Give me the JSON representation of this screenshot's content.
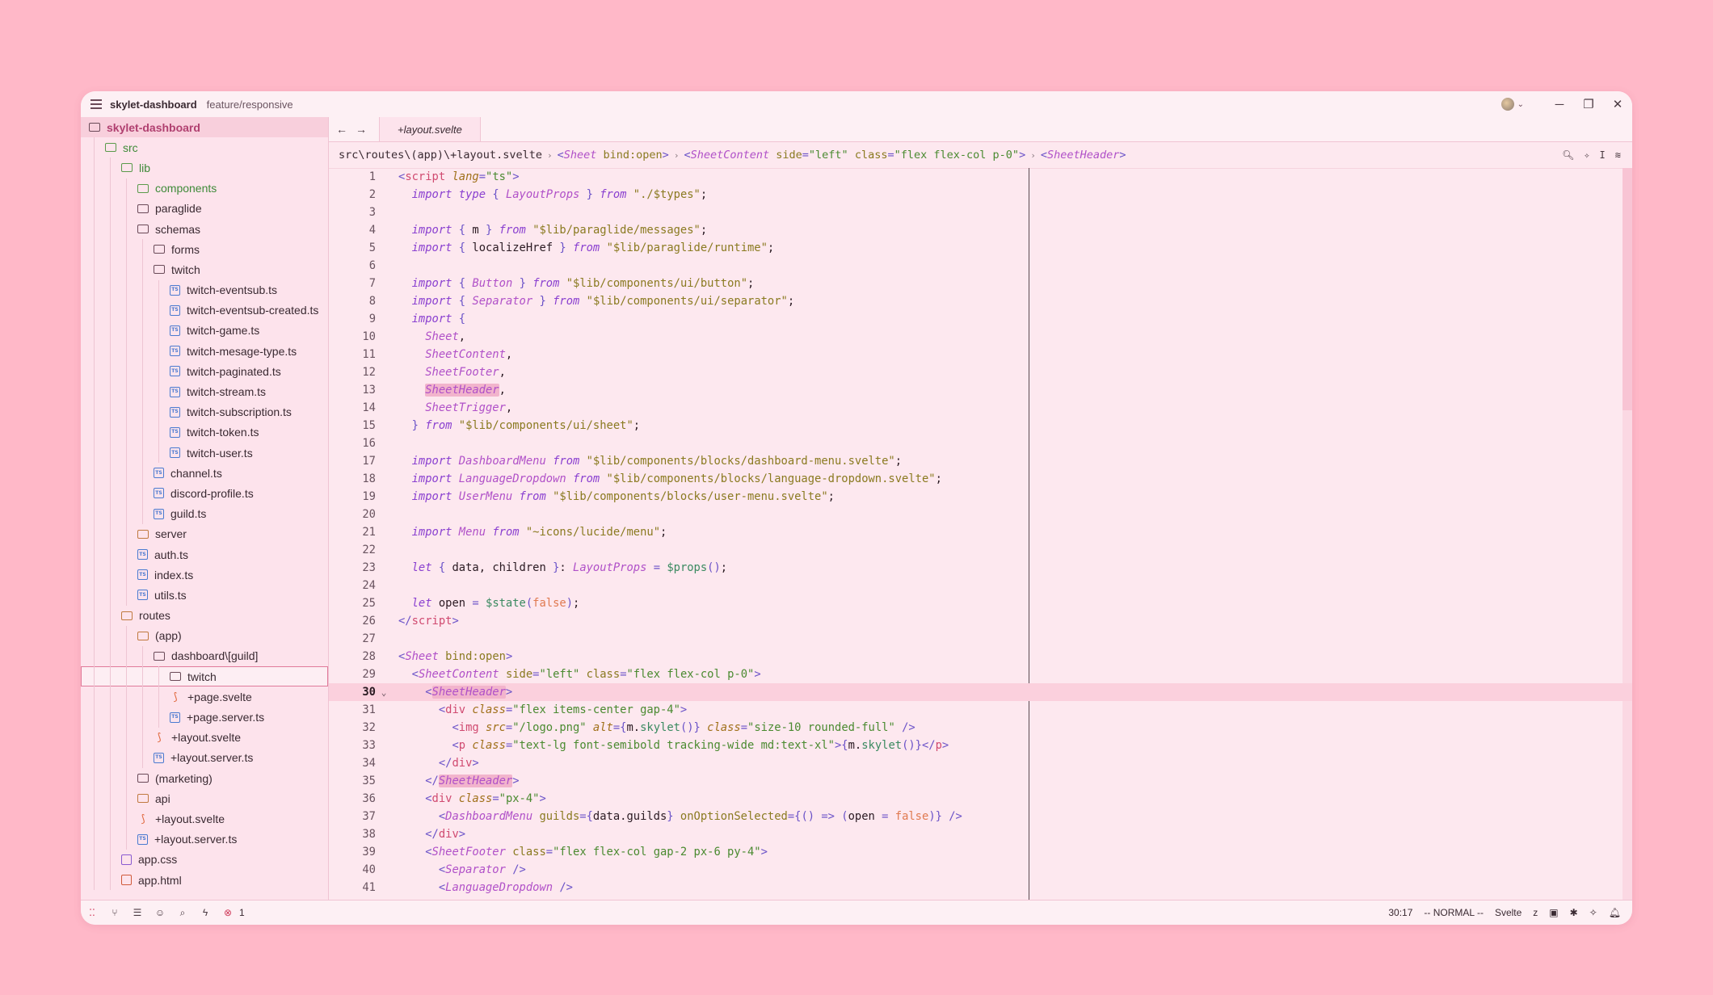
{
  "titlebar": {
    "project": "skylet-dashboard",
    "branch": "feature/responsive"
  },
  "sidebar": {
    "items": [
      {
        "label": "skylet-dashboard",
        "depth": 0,
        "icon": "folder-icon",
        "kind": "root"
      },
      {
        "label": "src",
        "depth": 1,
        "icon": "folder-icon",
        "color": "green"
      },
      {
        "label": "lib",
        "depth": 2,
        "icon": "folder-icon",
        "color": "green"
      },
      {
        "label": "components",
        "depth": 3,
        "icon": "folder-icon",
        "color": "green"
      },
      {
        "label": "paraglide",
        "depth": 3,
        "icon": "folder-icon"
      },
      {
        "label": "schemas",
        "depth": 3,
        "icon": "folder-icon"
      },
      {
        "label": "forms",
        "depth": 4,
        "icon": "folder-icon"
      },
      {
        "label": "twitch",
        "depth": 4,
        "icon": "folder-icon"
      },
      {
        "label": "twitch-eventsub.ts",
        "depth": 5,
        "icon": "ts-file-icon"
      },
      {
        "label": "twitch-eventsub-created.ts",
        "depth": 5,
        "icon": "ts-file-icon"
      },
      {
        "label": "twitch-game.ts",
        "depth": 5,
        "icon": "ts-file-icon"
      },
      {
        "label": "twitch-mesage-type.ts",
        "depth": 5,
        "icon": "ts-file-icon"
      },
      {
        "label": "twitch-paginated.ts",
        "depth": 5,
        "icon": "ts-file-icon"
      },
      {
        "label": "twitch-stream.ts",
        "depth": 5,
        "icon": "ts-file-icon"
      },
      {
        "label": "twitch-subscription.ts",
        "depth": 5,
        "icon": "ts-file-icon"
      },
      {
        "label": "twitch-token.ts",
        "depth": 5,
        "icon": "ts-file-icon"
      },
      {
        "label": "twitch-user.ts",
        "depth": 5,
        "icon": "ts-file-icon"
      },
      {
        "label": "channel.ts",
        "depth": 4,
        "icon": "ts-file-icon"
      },
      {
        "label": "discord-profile.ts",
        "depth": 4,
        "icon": "ts-file-icon"
      },
      {
        "label": "guild.ts",
        "depth": 4,
        "icon": "ts-file-icon"
      },
      {
        "label": "server",
        "depth": 3,
        "icon": "folder-icon",
        "color": "orange"
      },
      {
        "label": "auth.ts",
        "depth": 3,
        "icon": "ts-file-icon"
      },
      {
        "label": "index.ts",
        "depth": 3,
        "icon": "ts-file-icon"
      },
      {
        "label": "utils.ts",
        "depth": 3,
        "icon": "ts-file-icon"
      },
      {
        "label": "routes",
        "depth": 2,
        "icon": "folder-icon",
        "color": "orange"
      },
      {
        "label": "(app)",
        "depth": 3,
        "icon": "folder-icon",
        "color": "orange"
      },
      {
        "label": "dashboard\\[guild]",
        "depth": 4,
        "icon": "folder-icon"
      },
      {
        "label": "twitch",
        "depth": 5,
        "icon": "folder-icon",
        "kind": "selected"
      },
      {
        "label": "+page.svelte",
        "depth": 5,
        "icon": "svelte-file-icon"
      },
      {
        "label": "+page.server.ts",
        "depth": 5,
        "icon": "ts-file-icon"
      },
      {
        "label": "+layout.svelte",
        "depth": 4,
        "icon": "svelte-file-icon"
      },
      {
        "label": "+layout.server.ts",
        "depth": 4,
        "icon": "ts-file-icon"
      },
      {
        "label": "(marketing)",
        "depth": 3,
        "icon": "folder-icon"
      },
      {
        "label": "api",
        "depth": 3,
        "icon": "folder-icon",
        "color": "orange"
      },
      {
        "label": "+layout.svelte",
        "depth": 3,
        "icon": "svelte-file-icon"
      },
      {
        "label": "+layout.server.ts",
        "depth": 3,
        "icon": "ts-file-icon"
      },
      {
        "label": "app.css",
        "depth": 2,
        "icon": "css-file-icon"
      },
      {
        "label": "app.html",
        "depth": 2,
        "icon": "html-file-icon"
      }
    ]
  },
  "editor": {
    "tab_label": "+layout.svelte",
    "breadcrumb": {
      "path": "src\\routes\\(app)\\+layout.svelte",
      "c1_name": "Sheet",
      "c1_attr": "bind:open",
      "c2_name": "SheetContent",
      "c2_side_attr": "side",
      "c2_side_val": "\"left\"",
      "c2_class_attr": "class",
      "c2_class_val": "\"flex flex-col p-0\"",
      "c3_name": "SheetHeader"
    },
    "current_line": 30
  },
  "statusbar": {
    "error_count": "1",
    "cursor": "30:17",
    "mode": "-- NORMAL --",
    "language": "Svelte"
  }
}
